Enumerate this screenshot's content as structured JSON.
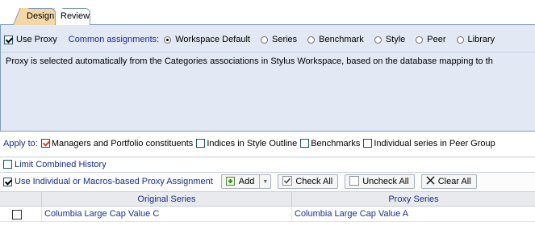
{
  "tabs": [
    {
      "label": "Design",
      "active": true
    },
    {
      "label": "Review",
      "active": false
    }
  ],
  "proxy": {
    "use_proxy_label": "Use Proxy",
    "use_proxy_checked": true,
    "common_assignments_label": "Common assignments:",
    "options": [
      {
        "label": "Workspace Default",
        "selected": true
      },
      {
        "label": "Series",
        "selected": false
      },
      {
        "label": "Benchmark",
        "selected": false
      },
      {
        "label": "Style",
        "selected": false
      },
      {
        "label": "Peer",
        "selected": false
      },
      {
        "label": "Library",
        "selected": false
      }
    ],
    "description": "Proxy is selected automatically from the Categories associations in Stylus Workspace, based on  the database mapping  to th"
  },
  "apply_to": {
    "label": "Apply to:",
    "items": [
      {
        "label": "Managers and Portfolio constituents",
        "checked": true
      },
      {
        "label": "Indices in Style Outline",
        "checked": false
      },
      {
        "label": "Benchmarks",
        "checked": false
      },
      {
        "label": "Individual series in Peer Group",
        "checked": false
      }
    ]
  },
  "limit_combined_history": {
    "label": "Limit Combined History",
    "checked": false
  },
  "toolbar": {
    "use_individual_label": "Use Individual or Macros-based Proxy Assignment",
    "use_individual_checked": true,
    "add_label": "Add",
    "check_all_label": "Check All",
    "uncheck_all_label": "Uncheck All",
    "clear_all_label": "Clear All"
  },
  "grid": {
    "columns": [
      "Original Series",
      "Proxy Series"
    ],
    "rows": [
      {
        "checked": false,
        "original": "Columbia Large Cap Value C",
        "proxy": "Columbia Large Cap Value A"
      }
    ]
  },
  "colors": {
    "label_blue": "#1a2f8c",
    "panel_bg": "#e2e8f4",
    "active_tab": "#f3d7a6",
    "check_orange": "#d2461a"
  }
}
